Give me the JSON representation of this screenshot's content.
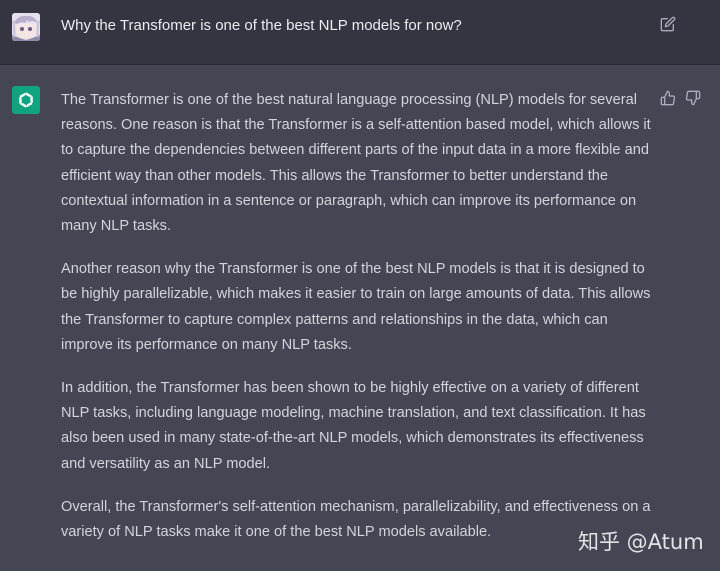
{
  "user": {
    "message": "Why the Transfomer is one of the best NLP models for now?"
  },
  "assistant": {
    "paragraphs": [
      "The Transformer is one of the best natural language processing (NLP) models for several reasons. One reason is that the Transformer is a self-attention based model, which allows it to capture the dependencies between different parts of the input data in a more flexible and efficient way than other models. This allows the Transformer to better understand the contextual information in a sentence or paragraph, which can improve its performance on many NLP tasks.",
      "Another reason why the Transformer is one of the best NLP models is that it is designed to be highly parallelizable, which makes it easier to train on large amounts of data. This allows the Transformer to capture complex patterns and relationships in the data, which can improve its performance on many NLP tasks.",
      "In addition, the Transformer has been shown to be highly effective on a variety of different NLP tasks, including language modeling, machine translation, and text classification. It has also been used in many state-of-the-art NLP models, which demonstrates its effectiveness and versatility as an NLP model.",
      "Overall, the Transformer's self-attention mechanism, parallelizability, and effectiveness on a variety of NLP tasks make it one of the best NLP models available."
    ]
  },
  "watermark": {
    "text": "知乎 @Atum"
  },
  "icons": {
    "user_avatar": "user-avatar-image",
    "assistant_avatar": "openai-logo-icon",
    "edit": "edit-icon",
    "thumbs_up": "thumbs-up-icon",
    "thumbs_down": "thumbs-down-icon"
  },
  "colors": {
    "user_row_bg": "#343541",
    "assistant_row_bg": "#444654",
    "assistant_avatar_bg": "#10a37f",
    "text": "#d1d5db"
  }
}
